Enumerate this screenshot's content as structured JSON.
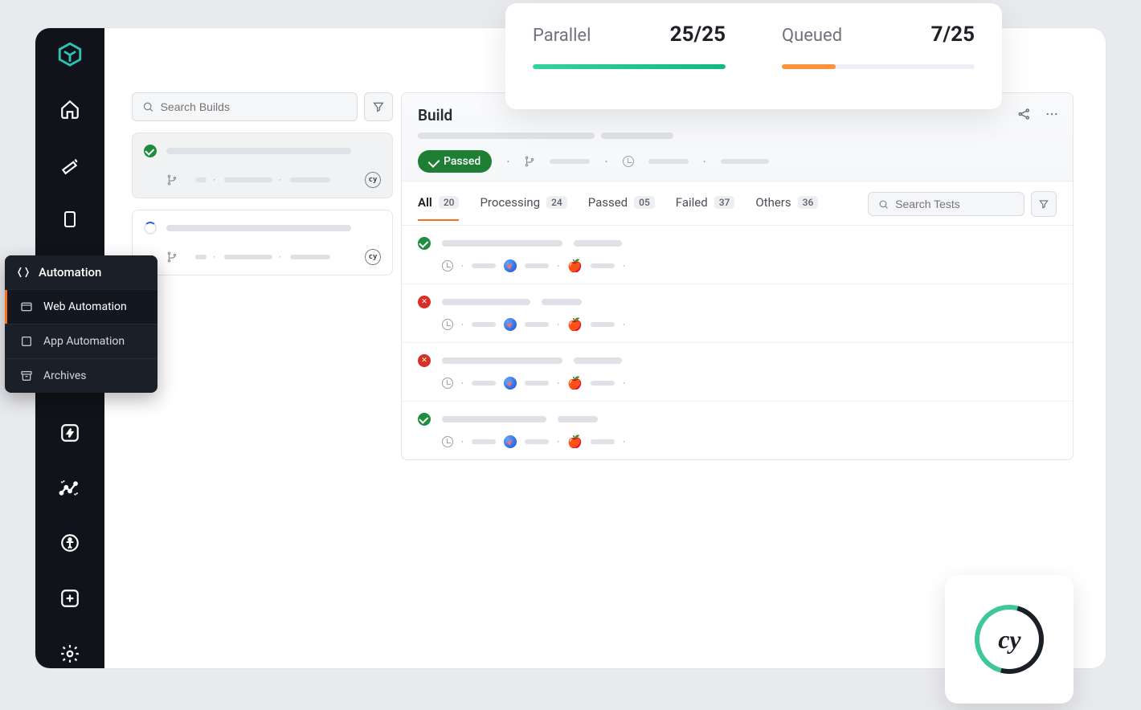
{
  "search": {
    "builds_placeholder": "Search Builds",
    "tests_placeholder": "Search Tests"
  },
  "submenu": {
    "title": "Automation",
    "items": [
      "Web Automation",
      "App Automation",
      "Archives"
    ],
    "active_index": 0
  },
  "build": {
    "title": "Build",
    "status_label": "Passed"
  },
  "tabs": [
    {
      "label": "All",
      "count": "20"
    },
    {
      "label": "Processing",
      "count": "24"
    },
    {
      "label": "Passed",
      "count": "05"
    },
    {
      "label": "Failed",
      "count": "37"
    },
    {
      "label": "Others",
      "count": "36"
    }
  ],
  "tests": [
    {
      "status": "pass"
    },
    {
      "status": "fail"
    },
    {
      "status": "fail"
    },
    {
      "status": "pass"
    }
  ],
  "stats": {
    "parallel": {
      "label": "Parallel",
      "value": "25/25",
      "fill_pct": 100,
      "color": "green"
    },
    "queued": {
      "label": "Queued",
      "value": "7/25",
      "fill_pct": 28,
      "color": "orange"
    }
  },
  "cypress_badge_text": "cy",
  "cypress_logo_text": "cy",
  "colors": {
    "accent_orange": "#f97316",
    "pass_green": "#1e8e3e",
    "fail_red": "#d93025"
  }
}
